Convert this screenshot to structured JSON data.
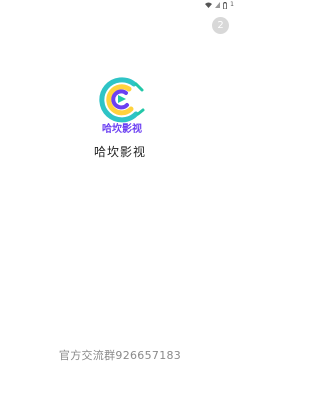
{
  "status_bar": {
    "icons": [
      "wifi-icon",
      "signal-icon",
      "battery-icon"
    ],
    "battery_text": "1"
  },
  "skip": {
    "countdown": "2"
  },
  "logo": {
    "wordmark": "哈坎影视",
    "colors": {
      "teal": "#2ec4c6",
      "yellow": "#ffd23c",
      "purple": "#6b3ff2",
      "green": "#22c7a8"
    }
  },
  "app_name": "哈坎影视",
  "footer": {
    "group_text": "官方交流群926657183"
  }
}
